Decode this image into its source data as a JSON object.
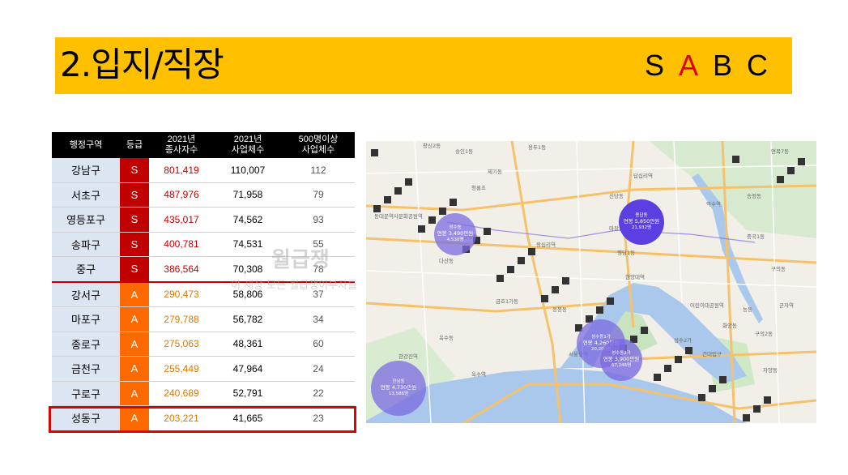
{
  "header": {
    "title": "2.입지/직장",
    "grades": [
      {
        "label": "S",
        "color": "#000000"
      },
      {
        "label": "A",
        "color": "#e00000"
      },
      {
        "label": "B",
        "color": "#000000"
      },
      {
        "label": "C",
        "color": "#000000"
      }
    ]
  },
  "table": {
    "columns": [
      "행정구역",
      "등급",
      "2021년\n종사자수",
      "2021년\n사업체수",
      "500명이상\n사업체수"
    ],
    "rows": [
      {
        "district": "강남구",
        "grade": "S",
        "workers": "801,419",
        "businesses": "110,007",
        "big": "112"
      },
      {
        "district": "서초구",
        "grade": "S",
        "workers": "487,976",
        "businesses": "71,958",
        "big": "79"
      },
      {
        "district": "영등포구",
        "grade": "S",
        "workers": "435,017",
        "businesses": "74,562",
        "big": "93"
      },
      {
        "district": "송파구",
        "grade": "S",
        "workers": "400,781",
        "businesses": "74,531",
        "big": "55"
      },
      {
        "district": "중구",
        "grade": "S",
        "workers": "386,564",
        "businesses": "70,308",
        "big": "78"
      },
      {
        "district": "강서구",
        "grade": "A",
        "workers": "290,473",
        "businesses": "58,806",
        "big": "37"
      },
      {
        "district": "마포구",
        "grade": "A",
        "workers": "279,788",
        "businesses": "56,782",
        "big": "34"
      },
      {
        "district": "종로구",
        "grade": "A",
        "workers": "275,063",
        "businesses": "48,361",
        "big": "60"
      },
      {
        "district": "금천구",
        "grade": "A",
        "workers": "255,449",
        "businesses": "47,964",
        "big": "24"
      },
      {
        "district": "구로구",
        "grade": "A",
        "workers": "240,689",
        "businesses": "52,791",
        "big": "22"
      },
      {
        "district": "성동구",
        "grade": "A",
        "workers": "203,221",
        "businesses": "41,665",
        "big": "23"
      }
    ]
  },
  "watermark": {
    "main": "월급쟁",
    "sub": "이 세상 모든 월급쟁이부자를"
  },
  "map": {
    "colors": {
      "river": "#a9c8ec",
      "park": "#c8e3bf",
      "road": "#f5c26b",
      "bubble": "#7b6be0",
      "bubble_dark": "#5b3fe0"
    },
    "bubbles": [
      {
        "name": "성수동",
        "salary": "연봉 3,490만원",
        "count": "4,530명"
      },
      {
        "name": "용답동",
        "salary": "연봉 5,850만원",
        "count": "21,932명"
      },
      {
        "name": "성수동1가",
        "salary": "연봉 4,260만원",
        "count": "20,200명"
      },
      {
        "name": "성수동2가",
        "salary": "연봉 3,900만원",
        "count": "67,246명"
      },
      {
        "name": "한남동",
        "salary": "연봉 4,730만원",
        "count": "13,586명"
      }
    ],
    "labels": [
      "창신2동",
      "숭인1동",
      "용두1동",
      "제기동",
      "청룡초",
      "신당동",
      "약수역",
      "왕십리역",
      "한양대역",
      "서울숲역",
      "금호1가동",
      "옥수동",
      "행당1동",
      "마장동",
      "답십리역",
      "자양동",
      "구의동",
      "중곡1동",
      "면목7동",
      "어린이대공원역",
      "건대입구",
      "뚝섬역",
      "옥수역",
      "한강진역",
      "한남동",
      "응봉동",
      "송정동",
      "능동",
      "화양동",
      "동대문역사문화공원역",
      "장충동",
      "다산동",
      "성수2가",
      "군자역",
      "구의2동"
    ]
  }
}
